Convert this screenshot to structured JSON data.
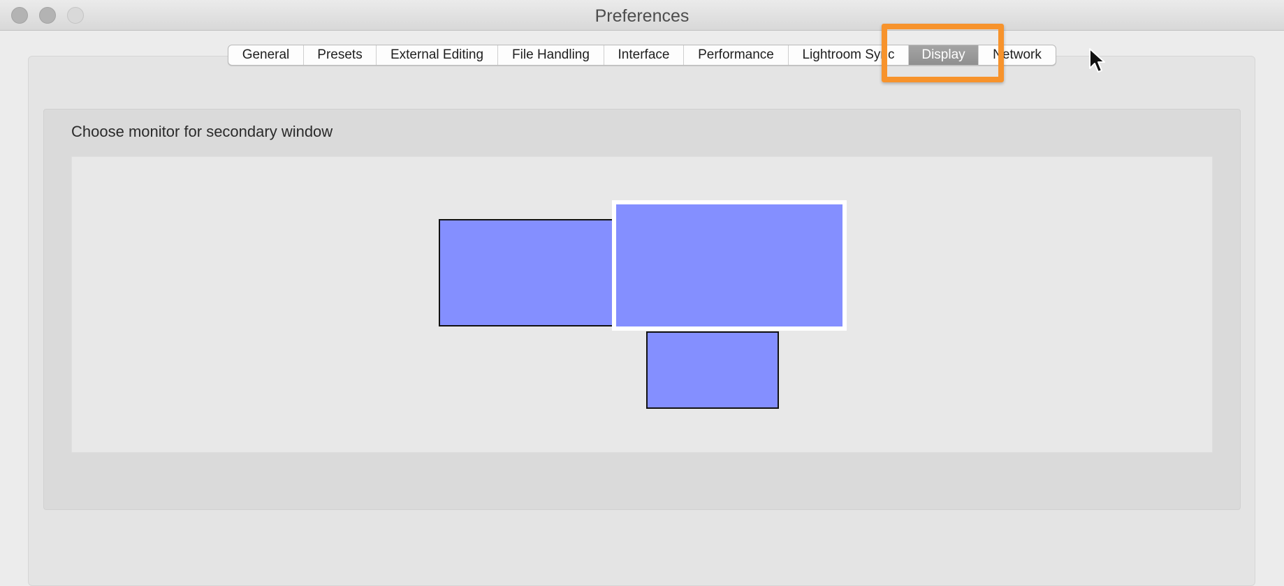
{
  "window": {
    "title": "Preferences"
  },
  "tabs": [
    {
      "label": "General",
      "selected": false
    },
    {
      "label": "Presets",
      "selected": false
    },
    {
      "label": "External Editing",
      "selected": false
    },
    {
      "label": "File Handling",
      "selected": false
    },
    {
      "label": "Interface",
      "selected": false
    },
    {
      "label": "Performance",
      "selected": false
    },
    {
      "label": "Lightroom Sync",
      "selected": false
    },
    {
      "label": "Display",
      "selected": true
    },
    {
      "label": "Network",
      "selected": false
    }
  ],
  "display_panel": {
    "section_label": "Choose monitor for secondary window",
    "monitors": [
      {
        "id": "left",
        "selected": false
      },
      {
        "id": "primary",
        "selected": true
      },
      {
        "id": "bottom",
        "selected": false
      }
    ]
  },
  "colors": {
    "monitor_fill": "#848fff",
    "highlight": "#f7932c",
    "selected_tab": "#999999"
  },
  "icons": {
    "pointer": "arrow-cursor-icon"
  }
}
